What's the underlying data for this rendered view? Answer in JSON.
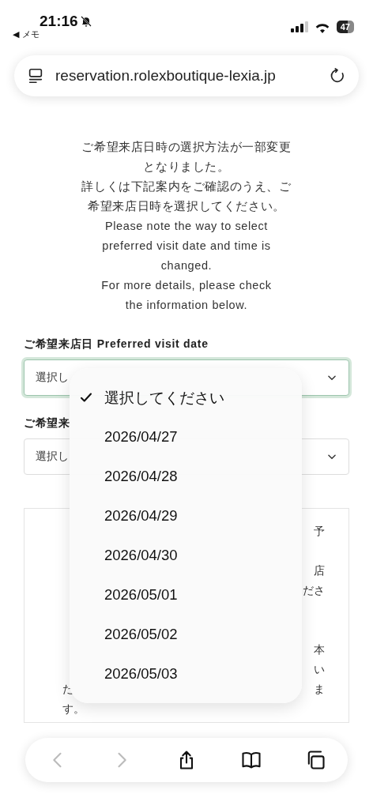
{
  "status_bar": {
    "time": "21:16",
    "back_app": "◀ メモ",
    "battery": "47"
  },
  "address_bar": {
    "url": "reservation.rolexboutique-lexia.jp"
  },
  "intro": [
    "ご希望来店日時の選択方法が一部変更",
    "となりました。",
    "詳しくは下記案内をご確認のうえ、ご",
    "希望来店日時を選択してください。",
    "Please note the way to select",
    "preferred visit date and time is",
    "changed.",
    "For more details, please check",
    "the information below."
  ],
  "fields": [
    {
      "label": "ご希望来店日 Preferred visit date",
      "value": "選択し",
      "focused": true
    },
    {
      "label": "ご希望来",
      "value": "選択し",
      "focused": false
    }
  ],
  "notice_lines": [
    {
      "kind": "text",
      "right": "予"
    },
    {
      "kind": "blank"
    },
    {
      "kind": "text",
      "right": "店"
    },
    {
      "kind": "text",
      "right": "ださ"
    },
    {
      "kind": "blank"
    },
    {
      "kind": "blank"
    },
    {
      "kind": "text",
      "right": "本"
    },
    {
      "kind": "text",
      "right": "い"
    },
    {
      "kind": "text",
      "left": "た",
      "right": "ま"
    },
    {
      "kind": "text",
      "left": "す。"
    }
  ],
  "dropdown": [
    {
      "label": "選択してください",
      "selected": true
    },
    {
      "label": "2026/04/27",
      "selected": false
    },
    {
      "label": "2026/04/28",
      "selected": false
    },
    {
      "label": "2026/04/29",
      "selected": false
    },
    {
      "label": "2026/04/30",
      "selected": false
    },
    {
      "label": "2026/05/01",
      "selected": false
    },
    {
      "label": "2026/05/02",
      "selected": false
    },
    {
      "label": "2026/05/03",
      "selected": false
    }
  ],
  "toolbar": [
    {
      "kind": "back",
      "disabled": true
    },
    {
      "kind": "forward",
      "disabled": true
    },
    {
      "kind": "share",
      "disabled": false
    },
    {
      "kind": "bookmarks",
      "disabled": false
    },
    {
      "kind": "tabs",
      "disabled": false
    }
  ]
}
